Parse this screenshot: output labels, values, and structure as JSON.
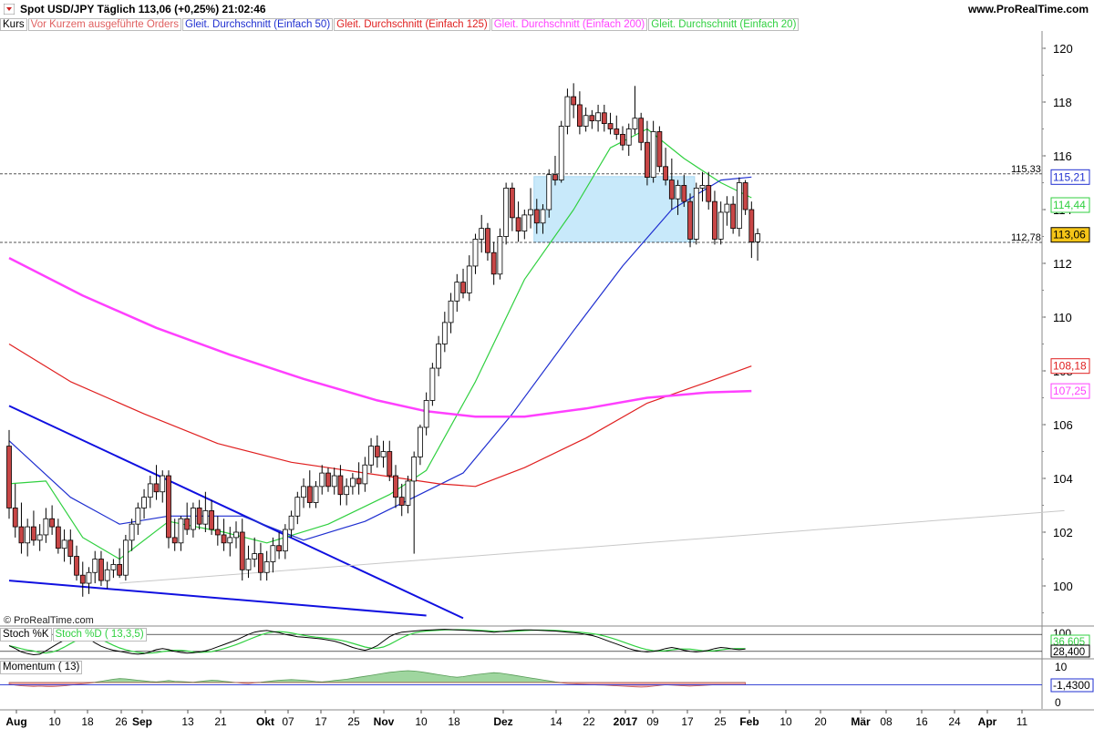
{
  "header": {
    "title": "Spot USD/JPY   Täglich   113,06 (+0,25%)   21:02:46",
    "brand": "www.ProRealTime.com"
  },
  "legend": [
    {
      "label": "Kurs",
      "color": "#000000"
    },
    {
      "label": "Vor Kurzem ausgeführte Orders",
      "color": "#e06060"
    },
    {
      "label": "Gleit. Durchschnitt (Einfach 50)",
      "color": "#1f2fd0"
    },
    {
      "label": "Gleit. Durchschnitt (Einfach 125)",
      "color": "#e02020"
    },
    {
      "label": "Gleit. Durchschnitt (Einfach 200)",
      "color": "#ff40ff"
    },
    {
      "label": "Gleit. Durchschnitt (Einfach 20)",
      "color": "#30d040"
    }
  ],
  "copyright": "© ProRealTime.com",
  "stoch_panel": {
    "labels": [
      {
        "label": "Stoch %K",
        "color": "#000000"
      },
      {
        "label": "Stoch %D ( 13,3,5)",
        "color": "#30d040"
      }
    ],
    "tick_partial": "100",
    "value_d": "36,605",
    "value_k": "28,400"
  },
  "momentum_panel": {
    "labels": [
      {
        "label": "Momentum ( 13)",
        "color": "#000000"
      }
    ],
    "value": "-1,4300",
    "ticks": [
      "10",
      "0"
    ]
  },
  "price_markers": [
    {
      "value": "115,21",
      "color": "#1f2fd0"
    },
    {
      "value": "114,44",
      "color": "#30d040"
    },
    {
      "value": "113,06",
      "color": "#000000",
      "bg": "#f5c518"
    },
    {
      "value": "108,18",
      "color": "#e02020"
    },
    {
      "value": "107,25",
      "color": "#ff40ff"
    }
  ],
  "hlines": [
    {
      "value": 115.33,
      "label": "115,33"
    },
    {
      "value": 112.78,
      "label": "112,78"
    }
  ],
  "x_axis": [
    "Aug",
    "10",
    "18",
    "26",
    "Sep",
    "13",
    "21",
    "Okt",
    "07",
    "17",
    "25",
    "Nov",
    "10",
    "18",
    "Dez",
    "14",
    "22",
    "2017",
    "09",
    "17",
    "25",
    "Feb",
    "10",
    "20",
    "Mär",
    "08",
    "16",
    "24",
    "Apr",
    "11"
  ],
  "chart_data": {
    "type": "candlestick",
    "title": "Spot USD/JPY",
    "ylim": [
      99,
      121
    ],
    "y_ticks": [
      100,
      102,
      104,
      106,
      108,
      110,
      112,
      114,
      116,
      118,
      120
    ],
    "zone": {
      "from_index": 86,
      "to_index": 108,
      "low": 112.78,
      "high": 115.21
    },
    "candles": [
      [
        105.2,
        105.8,
        102.5,
        102.9
      ],
      [
        102.9,
        103.8,
        101.8,
        102.2
      ],
      [
        102.2,
        103.1,
        101.2,
        101.6
      ],
      [
        101.6,
        102.5,
        101.1,
        102.2
      ],
      [
        102.2,
        102.8,
        101.5,
        101.7
      ],
      [
        101.7,
        102.3,
        101.3,
        101.9
      ],
      [
        101.9,
        102.9,
        101.6,
        102.5
      ],
      [
        102.5,
        103.0,
        101.9,
        102.2
      ],
      [
        102.2,
        102.5,
        101.2,
        101.4
      ],
      [
        101.4,
        102.1,
        100.9,
        101.7
      ],
      [
        101.7,
        102.1,
        100.8,
        101.1
      ],
      [
        101.1,
        101.5,
        100.2,
        100.4
      ],
      [
        100.4,
        100.9,
        99.6,
        100.1
      ],
      [
        100.1,
        100.7,
        99.7,
        100.5
      ],
      [
        100.5,
        101.3,
        100.1,
        101.0
      ],
      [
        101.0,
        101.3,
        100.0,
        100.2
      ],
      [
        100.2,
        100.9,
        99.9,
        100.6
      ],
      [
        100.6,
        101.0,
        100.3,
        100.8
      ],
      [
        100.8,
        101.4,
        100.3,
        100.4
      ],
      [
        100.4,
        101.9,
        100.2,
        101.7
      ],
      [
        101.7,
        102.5,
        101.3,
        102.3
      ],
      [
        102.3,
        103.1,
        101.9,
        102.9
      ],
      [
        102.9,
        103.6,
        102.5,
        103.3
      ],
      [
        103.3,
        104.1,
        102.9,
        103.8
      ],
      [
        103.8,
        104.5,
        103.2,
        103.5
      ],
      [
        103.5,
        104.3,
        103.1,
        104.1
      ],
      [
        104.1,
        104.3,
        101.4,
        101.8
      ],
      [
        101.8,
        102.5,
        101.3,
        101.6
      ],
      [
        101.6,
        102.6,
        101.3,
        102.5
      ],
      [
        102.5,
        103.1,
        101.9,
        102.1
      ],
      [
        102.1,
        103.1,
        101.8,
        102.9
      ],
      [
        102.9,
        103.2,
        102.1,
        102.3
      ],
      [
        102.3,
        103.5,
        102.0,
        102.8
      ],
      [
        102.8,
        103.2,
        101.9,
        102.1
      ],
      [
        102.1,
        102.6,
        101.5,
        101.9
      ],
      [
        101.9,
        102.5,
        101.3,
        101.6
      ],
      [
        101.6,
        102.2,
        101.1,
        101.8
      ],
      [
        101.8,
        102.4,
        101.4,
        102.0
      ],
      [
        102.0,
        102.5,
        100.2,
        100.6
      ],
      [
        100.6,
        101.5,
        100.3,
        101.0
      ],
      [
        101.0,
        101.8,
        100.7,
        101.2
      ],
      [
        101.2,
        101.6,
        100.2,
        100.5
      ],
      [
        100.5,
        101.3,
        100.2,
        100.9
      ],
      [
        100.9,
        101.8,
        100.5,
        101.5
      ],
      [
        101.5,
        102.0,
        101.0,
        101.3
      ],
      [
        101.3,
        102.3,
        101.0,
        102.1
      ],
      [
        102.1,
        102.8,
        101.8,
        102.6
      ],
      [
        102.6,
        103.5,
        102.3,
        103.3
      ],
      [
        103.3,
        104.0,
        102.9,
        103.7
      ],
      [
        103.7,
        104.3,
        102.9,
        103.1
      ],
      [
        103.1,
        103.9,
        102.9,
        103.7
      ],
      [
        103.7,
        104.5,
        103.4,
        104.2
      ],
      [
        104.2,
        104.4,
        103.5,
        103.7
      ],
      [
        103.7,
        104.4,
        103.4,
        104.1
      ],
      [
        104.1,
        104.5,
        103.0,
        103.4
      ],
      [
        103.4,
        104.0,
        103.0,
        103.7
      ],
      [
        103.7,
        104.2,
        103.4,
        104.0
      ],
      [
        104.0,
        104.6,
        103.4,
        103.8
      ],
      [
        103.8,
        104.8,
        103.5,
        104.5
      ],
      [
        104.5,
        105.5,
        104.2,
        105.2
      ],
      [
        105.2,
        105.6,
        104.4,
        104.8
      ],
      [
        104.8,
        105.4,
        104.4,
        105.0
      ],
      [
        105.0,
        105.4,
        103.9,
        104.1
      ],
      [
        104.1,
        104.5,
        102.9,
        103.3
      ],
      [
        103.3,
        103.8,
        102.6,
        103.0
      ],
      [
        103.0,
        104.1,
        102.7,
        103.9
      ],
      [
        103.9,
        105.0,
        101.2,
        104.8
      ],
      [
        104.8,
        106.0,
        104.5,
        105.9
      ],
      [
        105.9,
        107.2,
        105.6,
        106.9
      ],
      [
        106.9,
        108.3,
        106.7,
        108.1
      ],
      [
        108.1,
        109.3,
        107.8,
        109.0
      ],
      [
        109.0,
        110.2,
        108.7,
        109.8
      ],
      [
        109.8,
        110.9,
        109.4,
        110.6
      ],
      [
        110.6,
        111.6,
        110.2,
        111.3
      ],
      [
        111.3,
        111.8,
        110.7,
        110.9
      ],
      [
        110.9,
        112.3,
        110.6,
        111.9
      ],
      [
        111.9,
        113.1,
        111.6,
        112.9
      ],
      [
        112.9,
        113.8,
        112.4,
        113.3
      ],
      [
        113.3,
        113.5,
        112.1,
        112.4
      ],
      [
        112.4,
        112.8,
        111.2,
        111.6
      ],
      [
        111.6,
        113.3,
        111.4,
        113.0
      ],
      [
        113.0,
        115.0,
        112.7,
        114.8
      ],
      [
        114.8,
        115.0,
        113.2,
        113.7
      ],
      [
        113.7,
        114.3,
        112.8,
        113.2
      ],
      [
        113.2,
        114.0,
        112.9,
        113.8
      ],
      [
        113.8,
        114.8,
        113.3,
        114.0
      ],
      [
        114.0,
        114.4,
        113.1,
        113.5
      ],
      [
        113.5,
        114.2,
        113.1,
        114.0
      ],
      [
        114.0,
        115.5,
        113.7,
        115.3
      ],
      [
        115.3,
        116.0,
        114.9,
        115.1
      ],
      [
        115.1,
        117.3,
        115.0,
        117.1
      ],
      [
        117.1,
        118.5,
        116.8,
        118.2
      ],
      [
        118.2,
        118.7,
        117.4,
        117.9
      ],
      [
        117.9,
        118.4,
        116.8,
        117.1
      ],
      [
        117.1,
        117.8,
        116.9,
        117.5
      ],
      [
        117.5,
        117.7,
        117.0,
        117.3
      ],
      [
        117.3,
        117.9,
        116.9,
        117.6
      ],
      [
        117.6,
        117.9,
        116.9,
        117.2
      ],
      [
        117.2,
        117.6,
        116.8,
        117.0
      ],
      [
        117.0,
        117.5,
        116.6,
        116.8
      ],
      [
        116.8,
        117.1,
        116.2,
        116.4
      ],
      [
        116.4,
        117.2,
        116.0,
        117.0
      ],
      [
        117.0,
        118.6,
        116.8,
        117.4
      ],
      [
        117.4,
        117.6,
        116.2,
        116.5
      ],
      [
        116.5,
        117.3,
        114.9,
        115.2
      ],
      [
        115.2,
        117.3,
        115.0,
        116.9
      ],
      [
        116.9,
        117.1,
        115.4,
        115.6
      ],
      [
        115.6,
        116.3,
        114.9,
        115.1
      ],
      [
        115.1,
        115.9,
        114.0,
        114.4
      ],
      [
        114.4,
        115.1,
        113.8,
        114.9
      ],
      [
        114.9,
        115.3,
        114.1,
        114.3
      ],
      [
        114.3,
        114.6,
        112.6,
        112.9
      ],
      [
        112.9,
        115.0,
        112.7,
        114.8
      ],
      [
        114.8,
        115.4,
        114.3,
        114.9
      ],
      [
        114.9,
        115.4,
        114.0,
        114.3
      ],
      [
        114.3,
        114.7,
        112.7,
        112.9
      ],
      [
        112.9,
        114.3,
        112.7,
        113.9
      ],
      [
        113.9,
        114.5,
        113.4,
        114.2
      ],
      [
        114.2,
        114.5,
        113.1,
        113.3
      ],
      [
        113.3,
        115.2,
        113.0,
        115.0
      ],
      [
        115.0,
        115.1,
        113.8,
        114.0
      ],
      [
        114.0,
        114.3,
        112.2,
        112.8
      ],
      [
        112.8,
        113.3,
        112.1,
        113.1
      ]
    ],
    "series": [
      {
        "name": "Gleit. Durchschnitt (Einfach 20)",
        "color": "#30d040",
        "points": [
          [
            0,
            103.8
          ],
          [
            6,
            103.9
          ],
          [
            12,
            101.8
          ],
          [
            18,
            101.0
          ],
          [
            26,
            102.4
          ],
          [
            35,
            102.0
          ],
          [
            42,
            101.6
          ],
          [
            52,
            102.3
          ],
          [
            62,
            103.4
          ],
          [
            68,
            104.3
          ],
          [
            76,
            107.6
          ],
          [
            84,
            111.4
          ],
          [
            92,
            114.0
          ],
          [
            98,
            116.3
          ],
          [
            104,
            117.0
          ],
          [
            110,
            115.9
          ],
          [
            116,
            115.0
          ],
          [
            121,
            114.44
          ]
        ]
      },
      {
        "name": "Gleit. Durchschnitt (Einfach 50)",
        "color": "#1f2fd0",
        "points": [
          [
            0,
            105.4
          ],
          [
            10,
            103.3
          ],
          [
            18,
            102.3
          ],
          [
            26,
            102.6
          ],
          [
            38,
            102.6
          ],
          [
            48,
            101.7
          ],
          [
            58,
            102.4
          ],
          [
            66,
            103.3
          ],
          [
            74,
            104.2
          ],
          [
            82,
            106.4
          ],
          [
            92,
            109.5
          ],
          [
            100,
            111.9
          ],
          [
            108,
            114.0
          ],
          [
            116,
            115.1
          ],
          [
            121,
            115.21
          ]
        ]
      },
      {
        "name": "Gleit. Durchschnitt (Einfach 125)",
        "color": "#e02020",
        "points": [
          [
            0,
            109.0
          ],
          [
            10,
            107.6
          ],
          [
            22,
            106.4
          ],
          [
            34,
            105.3
          ],
          [
            46,
            104.6
          ],
          [
            58,
            104.2
          ],
          [
            70,
            103.8
          ],
          [
            76,
            103.7
          ],
          [
            84,
            104.4
          ],
          [
            94,
            105.5
          ],
          [
            104,
            106.8
          ],
          [
            114,
            107.6
          ],
          [
            121,
            108.18
          ]
        ]
      },
      {
        "name": "Gleit. Durchschnitt (Einfach 200)",
        "color": "#ff40ff",
        "points": [
          [
            0,
            112.2
          ],
          [
            12,
            110.8
          ],
          [
            24,
            109.6
          ],
          [
            36,
            108.6
          ],
          [
            48,
            107.7
          ],
          [
            60,
            106.9
          ],
          [
            68,
            106.5
          ],
          [
            76,
            106.3
          ],
          [
            84,
            106.3
          ],
          [
            94,
            106.6
          ],
          [
            104,
            107.0
          ],
          [
            114,
            107.2
          ],
          [
            121,
            107.25
          ]
        ]
      }
    ],
    "trendlines": [
      {
        "color": "#1010e0",
        "from": [
          0,
          106.7
        ],
        "to": [
          74,
          98.8
        ]
      },
      {
        "color": "#1010e0",
        "from": [
          0,
          100.2
        ],
        "to": [
          68,
          98.9
        ]
      },
      {
        "color": "#c8c8c8",
        "from": [
          18,
          100.1
        ],
        "to": [
          172,
          102.8
        ]
      }
    ]
  }
}
